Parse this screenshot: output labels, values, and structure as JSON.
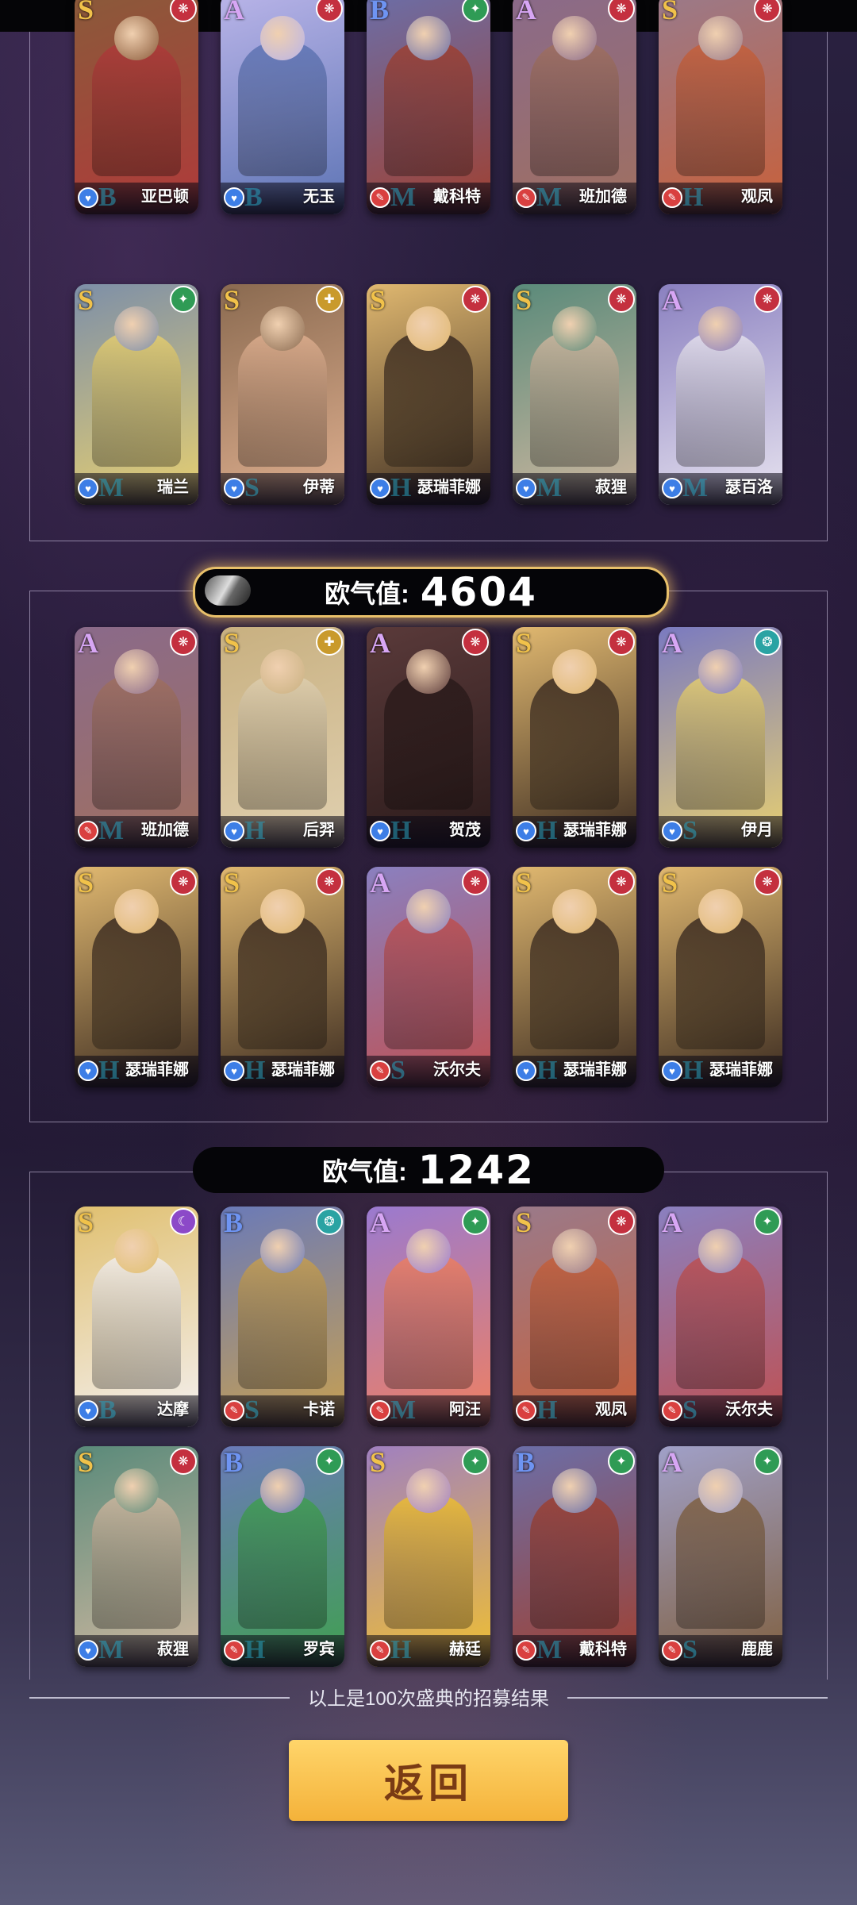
{
  "sections": [
    {
      "luck_label": "",
      "luck_value": "",
      "cards": [
        {
          "grade": "S",
          "name": "亚巴顿",
          "faction": "red",
          "role": "blue",
          "tier": "B",
          "c1": "#8a5a3a",
          "c2": "#b03a3a"
        },
        {
          "grade": "A",
          "name": "无玉",
          "faction": "red",
          "role": "blue",
          "tier": "B",
          "c1": "#b9b4e8",
          "c2": "#5d74b5"
        },
        {
          "grade": "B",
          "name": "戴科特",
          "faction": "green",
          "role": "red",
          "tier": "M",
          "c1": "#6b6ea8",
          "c2": "#a04030"
        },
        {
          "grade": "A",
          "name": "班加德",
          "faction": "red",
          "role": "red",
          "tier": "M",
          "c1": "#8a6a8a",
          "c2": "#a07060"
        },
        {
          "grade": "S",
          "name": "观凤",
          "faction": "red",
          "role": "red",
          "tier": "H",
          "c1": "#9a7a8a",
          "c2": "#c8603a"
        },
        {
          "grade": "S",
          "name": "瑞兰",
          "faction": "green",
          "role": "blue",
          "tier": "M",
          "c1": "#7d8fa8",
          "c2": "#e8d070"
        },
        {
          "grade": "S",
          "name": "伊蒂",
          "faction": "gold",
          "role": "blue",
          "tier": "S",
          "c1": "#8a6a50",
          "c2": "#e0b090"
        },
        {
          "grade": "S",
          "name": "瑟瑞菲娜",
          "faction": "red",
          "role": "blue",
          "tier": "H",
          "c1": "#e0b870",
          "c2": "#3a2a20"
        },
        {
          "grade": "S",
          "name": "菽狸",
          "faction": "red",
          "role": "blue",
          "tier": "M",
          "c1": "#5a8a7a",
          "c2": "#d0b8a0"
        },
        {
          "grade": "A",
          "name": "瑟百洛",
          "faction": "red",
          "role": "blue",
          "tier": "M",
          "c1": "#8a80c0",
          "c2": "#e8e4f0"
        }
      ]
    },
    {
      "luck_label": "欧气值:",
      "luck_value": "4604",
      "cards": [
        {
          "grade": "A",
          "name": "班加德",
          "faction": "red",
          "role": "red",
          "tier": "M",
          "c1": "#8a6a8a",
          "c2": "#a07060"
        },
        {
          "grade": "S",
          "name": "后羿",
          "faction": "gold",
          "role": "blue",
          "tier": "H",
          "c1": "#c8b080",
          "c2": "#e0d0b0"
        },
        {
          "grade": "A",
          "name": "贺茂",
          "faction": "red",
          "role": "blue",
          "tier": "H",
          "c1": "#5a3a3a",
          "c2": "#2a1a1a"
        },
        {
          "grade": "S",
          "name": "瑟瑞菲娜",
          "faction": "red",
          "role": "blue",
          "tier": "H",
          "c1": "#e0b870",
          "c2": "#3a2a20"
        },
        {
          "grade": "A",
          "name": "伊月",
          "faction": "teal",
          "role": "blue",
          "tier": "S",
          "c1": "#7a7ac0",
          "c2": "#e8d070"
        },
        {
          "grade": "S",
          "name": "瑟瑞菲娜",
          "faction": "red",
          "role": "blue",
          "tier": "H",
          "c1": "#e0b870",
          "c2": "#3a2a20"
        },
        {
          "grade": "S",
          "name": "瑟瑞菲娜",
          "faction": "red",
          "role": "blue",
          "tier": "H",
          "c1": "#e0b870",
          "c2": "#3a2a20"
        },
        {
          "grade": "A",
          "name": "沃尔夫",
          "faction": "red",
          "role": "red",
          "tier": "S",
          "c1": "#8a80c0",
          "c2": "#c05050"
        },
        {
          "grade": "S",
          "name": "瑟瑞菲娜",
          "faction": "red",
          "role": "blue",
          "tier": "H",
          "c1": "#e0b870",
          "c2": "#3a2a20"
        },
        {
          "grade": "S",
          "name": "瑟瑞菲娜",
          "faction": "red",
          "role": "blue",
          "tier": "H",
          "c1": "#e0b870",
          "c2": "#3a2a20"
        }
      ]
    },
    {
      "luck_label": "欧气值:",
      "luck_value": "1242",
      "cards": [
        {
          "grade": "S",
          "name": "达摩",
          "faction": "purple",
          "role": "blue",
          "tier": "B",
          "c1": "#e0c070",
          "c2": "#f4f0f0"
        },
        {
          "grade": "B",
          "name": "卡诺",
          "faction": "teal",
          "role": "red",
          "tier": "S",
          "c1": "#6a7ab8",
          "c2": "#c8a050"
        },
        {
          "grade": "A",
          "name": "阿汪",
          "faction": "green",
          "role": "red",
          "tier": "M",
          "c1": "#9a7ad0",
          "c2": "#f08060"
        },
        {
          "grade": "S",
          "name": "观凤",
          "faction": "red",
          "role": "red",
          "tier": "H",
          "c1": "#9a7a8a",
          "c2": "#c8603a"
        },
        {
          "grade": "A",
          "name": "沃尔夫",
          "faction": "green",
          "role": "red",
          "tier": "S",
          "c1": "#8a80c0",
          "c2": "#c05050"
        },
        {
          "grade": "S",
          "name": "菽狸",
          "faction": "red",
          "role": "blue",
          "tier": "M",
          "c1": "#5a8a7a",
          "c2": "#d0b8a0"
        },
        {
          "grade": "B",
          "name": "罗宾",
          "faction": "green",
          "role": "red",
          "tier": "H",
          "c1": "#6a7ab8",
          "c2": "#40a050"
        },
        {
          "grade": "S",
          "name": "赫廷",
          "faction": "green",
          "role": "red",
          "tier": "H",
          "c1": "#a080c0",
          "c2": "#f0c030"
        },
        {
          "grade": "B",
          "name": "戴科特",
          "faction": "green",
          "role": "red",
          "tier": "M",
          "c1": "#6b6ea8",
          "c2": "#a04030"
        },
        {
          "grade": "A",
          "name": "鹿鹿",
          "faction": "green",
          "role": "red",
          "tier": "S",
          "c1": "#a0a0c8",
          "c2": "#806040"
        }
      ]
    }
  ],
  "footer_text": "以上是100次盛典的招募结果",
  "return_button": "返回"
}
